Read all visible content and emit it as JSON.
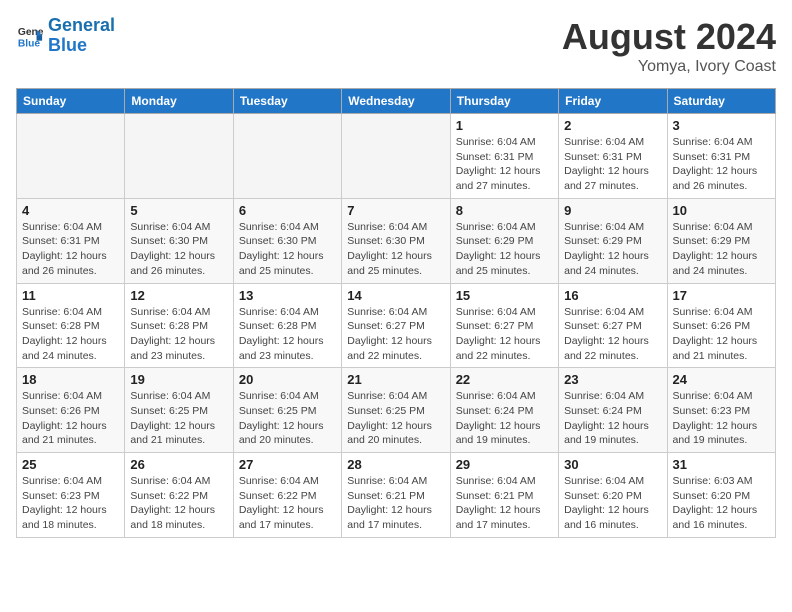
{
  "header": {
    "logo_line1": "General",
    "logo_line2": "Blue",
    "month_year": "August 2024",
    "location": "Yomya, Ivory Coast"
  },
  "weekdays": [
    "Sunday",
    "Monday",
    "Tuesday",
    "Wednesday",
    "Thursday",
    "Friday",
    "Saturday"
  ],
  "weeks": [
    [
      {
        "day": "",
        "info": ""
      },
      {
        "day": "",
        "info": ""
      },
      {
        "day": "",
        "info": ""
      },
      {
        "day": "",
        "info": ""
      },
      {
        "day": "1",
        "info": "Sunrise: 6:04 AM\nSunset: 6:31 PM\nDaylight: 12 hours\nand 27 minutes."
      },
      {
        "day": "2",
        "info": "Sunrise: 6:04 AM\nSunset: 6:31 PM\nDaylight: 12 hours\nand 27 minutes."
      },
      {
        "day": "3",
        "info": "Sunrise: 6:04 AM\nSunset: 6:31 PM\nDaylight: 12 hours\nand 26 minutes."
      }
    ],
    [
      {
        "day": "4",
        "info": "Sunrise: 6:04 AM\nSunset: 6:31 PM\nDaylight: 12 hours\nand 26 minutes."
      },
      {
        "day": "5",
        "info": "Sunrise: 6:04 AM\nSunset: 6:30 PM\nDaylight: 12 hours\nand 26 minutes."
      },
      {
        "day": "6",
        "info": "Sunrise: 6:04 AM\nSunset: 6:30 PM\nDaylight: 12 hours\nand 25 minutes."
      },
      {
        "day": "7",
        "info": "Sunrise: 6:04 AM\nSunset: 6:30 PM\nDaylight: 12 hours\nand 25 minutes."
      },
      {
        "day": "8",
        "info": "Sunrise: 6:04 AM\nSunset: 6:29 PM\nDaylight: 12 hours\nand 25 minutes."
      },
      {
        "day": "9",
        "info": "Sunrise: 6:04 AM\nSunset: 6:29 PM\nDaylight: 12 hours\nand 24 minutes."
      },
      {
        "day": "10",
        "info": "Sunrise: 6:04 AM\nSunset: 6:29 PM\nDaylight: 12 hours\nand 24 minutes."
      }
    ],
    [
      {
        "day": "11",
        "info": "Sunrise: 6:04 AM\nSunset: 6:28 PM\nDaylight: 12 hours\nand 24 minutes."
      },
      {
        "day": "12",
        "info": "Sunrise: 6:04 AM\nSunset: 6:28 PM\nDaylight: 12 hours\nand 23 minutes."
      },
      {
        "day": "13",
        "info": "Sunrise: 6:04 AM\nSunset: 6:28 PM\nDaylight: 12 hours\nand 23 minutes."
      },
      {
        "day": "14",
        "info": "Sunrise: 6:04 AM\nSunset: 6:27 PM\nDaylight: 12 hours\nand 22 minutes."
      },
      {
        "day": "15",
        "info": "Sunrise: 6:04 AM\nSunset: 6:27 PM\nDaylight: 12 hours\nand 22 minutes."
      },
      {
        "day": "16",
        "info": "Sunrise: 6:04 AM\nSunset: 6:27 PM\nDaylight: 12 hours\nand 22 minutes."
      },
      {
        "day": "17",
        "info": "Sunrise: 6:04 AM\nSunset: 6:26 PM\nDaylight: 12 hours\nand 21 minutes."
      }
    ],
    [
      {
        "day": "18",
        "info": "Sunrise: 6:04 AM\nSunset: 6:26 PM\nDaylight: 12 hours\nand 21 minutes."
      },
      {
        "day": "19",
        "info": "Sunrise: 6:04 AM\nSunset: 6:25 PM\nDaylight: 12 hours\nand 21 minutes."
      },
      {
        "day": "20",
        "info": "Sunrise: 6:04 AM\nSunset: 6:25 PM\nDaylight: 12 hours\nand 20 minutes."
      },
      {
        "day": "21",
        "info": "Sunrise: 6:04 AM\nSunset: 6:25 PM\nDaylight: 12 hours\nand 20 minutes."
      },
      {
        "day": "22",
        "info": "Sunrise: 6:04 AM\nSunset: 6:24 PM\nDaylight: 12 hours\nand 19 minutes."
      },
      {
        "day": "23",
        "info": "Sunrise: 6:04 AM\nSunset: 6:24 PM\nDaylight: 12 hours\nand 19 minutes."
      },
      {
        "day": "24",
        "info": "Sunrise: 6:04 AM\nSunset: 6:23 PM\nDaylight: 12 hours\nand 19 minutes."
      }
    ],
    [
      {
        "day": "25",
        "info": "Sunrise: 6:04 AM\nSunset: 6:23 PM\nDaylight: 12 hours\nand 18 minutes."
      },
      {
        "day": "26",
        "info": "Sunrise: 6:04 AM\nSunset: 6:22 PM\nDaylight: 12 hours\nand 18 minutes."
      },
      {
        "day": "27",
        "info": "Sunrise: 6:04 AM\nSunset: 6:22 PM\nDaylight: 12 hours\nand 17 minutes."
      },
      {
        "day": "28",
        "info": "Sunrise: 6:04 AM\nSunset: 6:21 PM\nDaylight: 12 hours\nand 17 minutes."
      },
      {
        "day": "29",
        "info": "Sunrise: 6:04 AM\nSunset: 6:21 PM\nDaylight: 12 hours\nand 17 minutes."
      },
      {
        "day": "30",
        "info": "Sunrise: 6:04 AM\nSunset: 6:20 PM\nDaylight: 12 hours\nand 16 minutes."
      },
      {
        "day": "31",
        "info": "Sunrise: 6:03 AM\nSunset: 6:20 PM\nDaylight: 12 hours\nand 16 minutes."
      }
    ]
  ]
}
